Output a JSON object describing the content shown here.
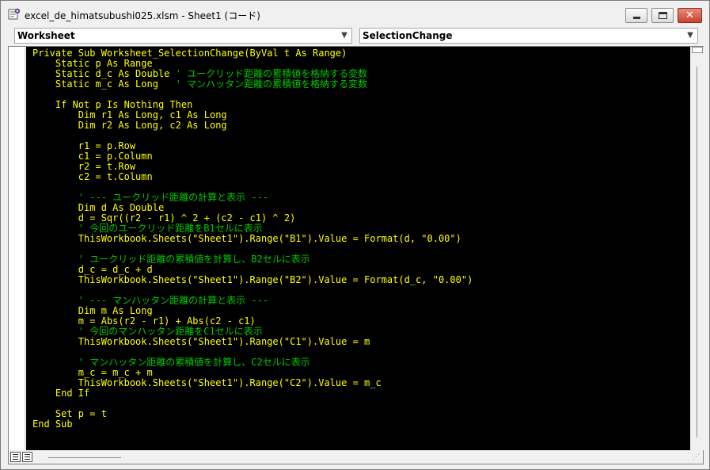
{
  "window": {
    "title": "excel_de_himatsubushi025.xlsm - Sheet1 (コード)",
    "app_icon": "vba-module-icon"
  },
  "object_dropdown": {
    "value": "Worksheet"
  },
  "procedure_dropdown": {
    "value": "SelectionChange"
  },
  "code": [
    [
      {
        "t": "Private Sub Worksheet_SelectionChange(ByVal t As Range)"
      }
    ],
    [
      {
        "t": "    Static p As Range"
      }
    ],
    [
      {
        "t": "    Static d_c As Double "
      },
      {
        "t": "' ユークリッド距離の累積値を格納する変数",
        "c": true
      }
    ],
    [
      {
        "t": "    Static m_c As Long   "
      },
      {
        "t": "' マンハッタン距離の累積値を格納する変数",
        "c": true
      }
    ],
    [
      {
        "t": ""
      }
    ],
    [
      {
        "t": "    If Not p Is Nothing Then"
      }
    ],
    [
      {
        "t": "        Dim r1 As Long, c1 As Long"
      }
    ],
    [
      {
        "t": "        Dim r2 As Long, c2 As Long"
      }
    ],
    [
      {
        "t": ""
      }
    ],
    [
      {
        "t": "        r1 = p.Row"
      }
    ],
    [
      {
        "t": "        c1 = p.Column"
      }
    ],
    [
      {
        "t": "        r2 = t.Row"
      }
    ],
    [
      {
        "t": "        c2 = t.Column"
      }
    ],
    [
      {
        "t": ""
      }
    ],
    [
      {
        "t": "        "
      },
      {
        "t": "' --- ユークリッド距離の計算と表示 ---",
        "c": true
      }
    ],
    [
      {
        "t": "        Dim d As Double"
      }
    ],
    [
      {
        "t": "        d = Sqr((r2 - r1) ^ 2 + (c2 - c1) ^ 2)"
      }
    ],
    [
      {
        "t": "        "
      },
      {
        "t": "' 今回のユークリッド距離をB1セルに表示",
        "c": true
      }
    ],
    [
      {
        "t": "        ThisWorkbook.Sheets(\"Sheet1\").Range(\"B1\").Value = Format(d, \"0.00\")"
      }
    ],
    [
      {
        "t": ""
      }
    ],
    [
      {
        "t": "        "
      },
      {
        "t": "' ユークリッド距離の累積値を計算し、B2セルに表示",
        "c": true
      }
    ],
    [
      {
        "t": "        d_c = d_c + d"
      }
    ],
    [
      {
        "t": "        ThisWorkbook.Sheets(\"Sheet1\").Range(\"B2\").Value = Format(d_c, \"0.00\")"
      }
    ],
    [
      {
        "t": ""
      }
    ],
    [
      {
        "t": "        "
      },
      {
        "t": "' --- マンハッタン距離の計算と表示 ---",
        "c": true
      }
    ],
    [
      {
        "t": "        Dim m As Long"
      }
    ],
    [
      {
        "t": "        m = Abs(r2 - r1) + Abs(c2 - c1)"
      }
    ],
    [
      {
        "t": "        "
      },
      {
        "t": "' 今回のマンハッタン距離をC1セルに表示",
        "c": true
      }
    ],
    [
      {
        "t": "        ThisWorkbook.Sheets(\"Sheet1\").Range(\"C1\").Value = m"
      }
    ],
    [
      {
        "t": ""
      }
    ],
    [
      {
        "t": "        "
      },
      {
        "t": "' マンハッタン距離の累積値を計算し、C2セルに表示",
        "c": true
      }
    ],
    [
      {
        "t": "        m_c = m_c + m"
      }
    ],
    [
      {
        "t": "        ThisWorkbook.Sheets(\"Sheet1\").Range(\"C2\").Value = m_c"
      }
    ],
    [
      {
        "t": "    End If"
      }
    ],
    [
      {
        "t": ""
      }
    ],
    [
      {
        "t": "    Set p = t"
      }
    ],
    [
      {
        "t": "End Sub"
      }
    ]
  ],
  "colors": {
    "code_background": "#000000",
    "code_text": "#ffff00",
    "comment_text": "#00c800"
  }
}
